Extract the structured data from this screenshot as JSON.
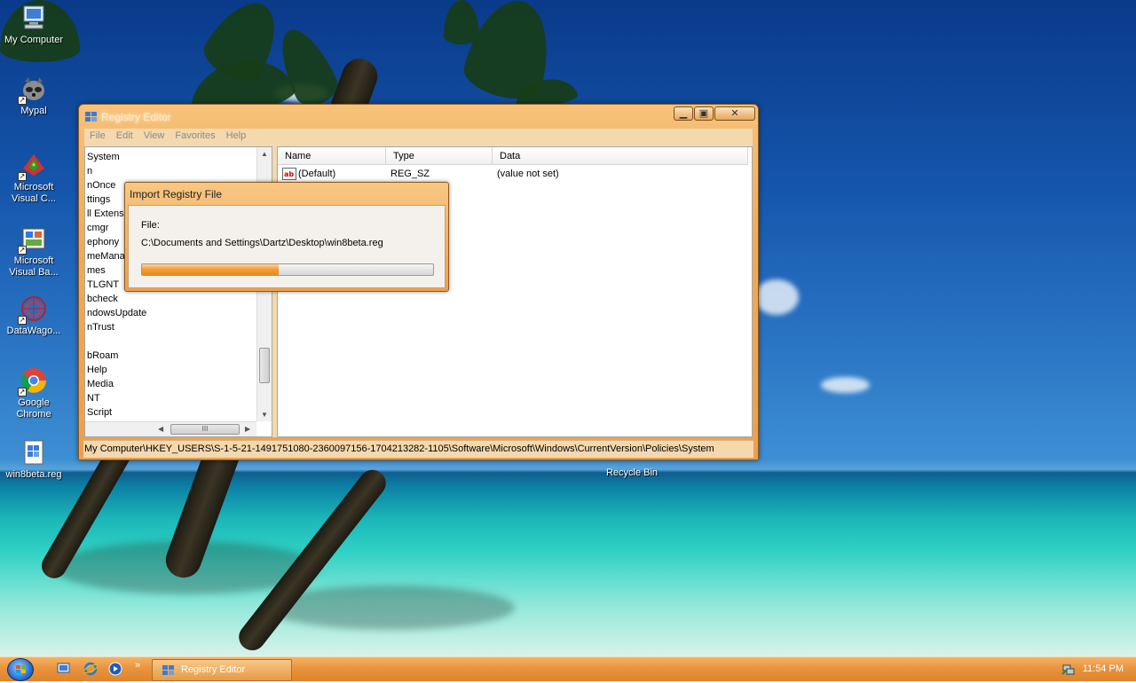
{
  "desktop": {
    "icons": [
      {
        "label_line1": "My Computer",
        "label_line2": ""
      },
      {
        "label_line1": "Mypal",
        "label_line2": ""
      },
      {
        "label_line1": "Microsoft",
        "label_line2": "Visual C..."
      },
      {
        "label_line1": "Microsoft",
        "label_line2": "Visual Ba..."
      },
      {
        "label_line1": "DataWago...",
        "label_line2": ""
      },
      {
        "label_line1": "Google",
        "label_line2": "Chrome"
      },
      {
        "label_line1": "win8beta.reg",
        "label_line2": ""
      },
      {
        "label_line1": "Recycle Bin",
        "label_line2": ""
      }
    ]
  },
  "regedit": {
    "title": "Registry Editor",
    "menu": [
      "File",
      "Edit",
      "View",
      "Favorites",
      "Help"
    ],
    "tree_items": [
      "System",
      "n",
      "nOnce",
      "ttings",
      "ll Extensi",
      "cmgr",
      "ephony",
      "meMana",
      "mes",
      "TLGNT",
      "bcheck",
      "ndowsUpdate",
      "nTrust",
      "",
      "bRoam",
      "Help",
      "Media",
      "NT",
      "Script"
    ],
    "columns": [
      "Name",
      "Type",
      "Data"
    ],
    "rows": [
      {
        "name": "(Default)",
        "type": "REG_SZ",
        "data": "(value not set)"
      }
    ],
    "statusbar": "My Computer\\HKEY_USERS\\S-1-5-21-1491751080-2360097156-1704213282-1105\\Software\\Microsoft\\Windows\\CurrentVersion\\Policies\\System",
    "hscroll_grip": "III"
  },
  "import_dialog": {
    "title": "Import Registry File",
    "file_label": "File:",
    "file_path": "C:\\Documents and Settings\\Dartz\\Desktop\\win8beta.reg",
    "progress": 0.47
  },
  "taskbar": {
    "overflow_glyph": "»",
    "task_label": "Registry Editor",
    "clock": "11:54 PM"
  },
  "colors": {
    "window_frame": "#eda04c",
    "progress_fill": "#f39a34",
    "taskbar": "#e9943e"
  }
}
